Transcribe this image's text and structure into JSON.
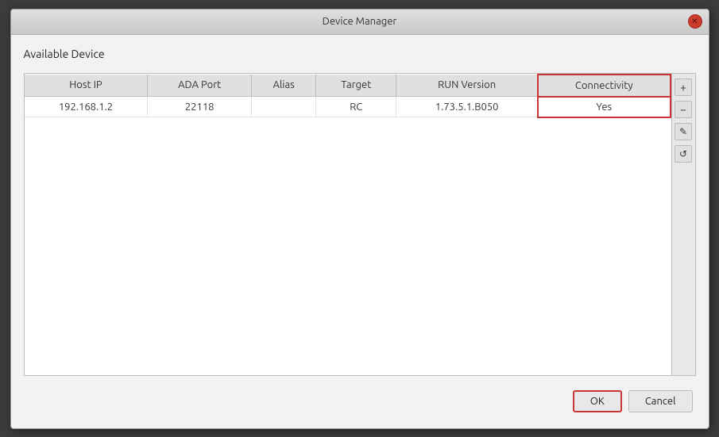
{
  "window": {
    "title": "Device Manager",
    "close_label": "✕"
  },
  "section": {
    "title": "Available Device"
  },
  "table": {
    "columns": [
      {
        "key": "host_ip",
        "label": "Host IP",
        "is_connectivity": false
      },
      {
        "key": "ada_port",
        "label": "ADA Port",
        "is_connectivity": false
      },
      {
        "key": "alias",
        "label": "Alias",
        "is_connectivity": false
      },
      {
        "key": "target",
        "label": "Target",
        "is_connectivity": false
      },
      {
        "key": "run_version",
        "label": "RUN Version",
        "is_connectivity": false
      },
      {
        "key": "connectivity",
        "label": "Connectivity",
        "is_connectivity": true
      }
    ],
    "rows": [
      {
        "host_ip": "192.168.1.2",
        "ada_port": "22118",
        "alias": "",
        "target": "RC",
        "run_version": "1.73.5.1.B050",
        "connectivity": "Yes"
      }
    ]
  },
  "sidebar_buttons": [
    {
      "label": "+",
      "name": "add-button"
    },
    {
      "label": "−",
      "name": "remove-button"
    },
    {
      "label": "✎",
      "name": "edit-button"
    },
    {
      "label": "↺",
      "name": "refresh-button"
    }
  ],
  "footer": {
    "ok_label": "OK",
    "cancel_label": "Cancel"
  }
}
